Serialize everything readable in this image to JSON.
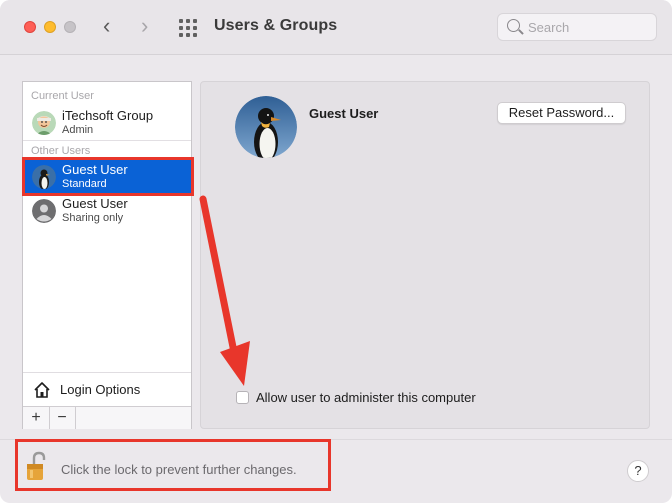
{
  "window": {
    "title": "Users & Groups",
    "search_placeholder": "Search",
    "nav_back": "‹",
    "nav_forward": "›"
  },
  "user_list": {
    "current_user_header": "Current User",
    "other_users_header": "Other Users",
    "users": [
      {
        "name": "iTechsoft Group",
        "role": "Admin",
        "selected": false
      },
      {
        "name": "Guest User",
        "role": "Standard",
        "selected": true
      },
      {
        "name": "Guest User",
        "role": "Sharing only",
        "selected": false
      }
    ],
    "login_options_label": "Login Options",
    "add_label": "+",
    "remove_label": "−"
  },
  "detail": {
    "user_name": "Guest User",
    "reset_password_label": "Reset Password...",
    "admin_checkbox_label": "Allow user to administer this computer",
    "admin_checked": false
  },
  "footer": {
    "lock_text": "Click the lock to prevent further changes.",
    "help_label": "?"
  },
  "colors": {
    "selection": "#0a62d6",
    "annotation_red": "#e8362b"
  },
  "icons": [
    "search-icon",
    "grid-icon",
    "house-icon",
    "lock-open-icon",
    "penguin-avatar-icon",
    "generic-user-icon",
    "memoji-avatar-icon"
  ]
}
